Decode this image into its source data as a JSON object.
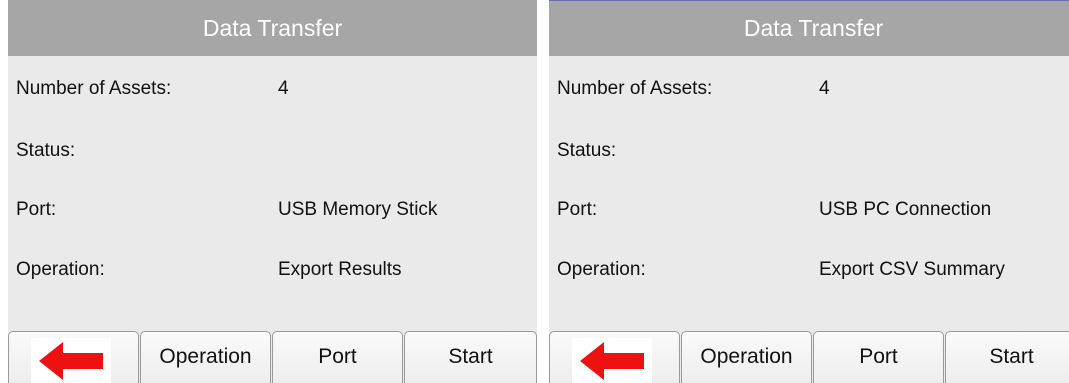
{
  "panels": [
    {
      "title": "Data Transfer",
      "number_of_assets_label": "Number of Assets:",
      "number_of_assets_value": "4",
      "status_label": "Status:",
      "status_value": "",
      "port_label": "Port:",
      "port_value": "USB Memory Stick",
      "operation_label": "Operation:",
      "operation_value": "Export Results",
      "buttons": {
        "back_icon": "left-arrow-icon",
        "operation": "Operation",
        "port": "Port",
        "start": "Start"
      }
    },
    {
      "title": "Data Transfer",
      "number_of_assets_label": "Number of Assets:",
      "number_of_assets_value": "4",
      "status_label": "Status:",
      "status_value": "",
      "port_label": "Port:",
      "port_value": "USB PC Connection",
      "operation_label": "Operation:",
      "operation_value": "Export CSV Summary",
      "buttons": {
        "back_icon": "left-arrow-icon",
        "operation": "Operation",
        "port": "Port",
        "start": "Start"
      }
    }
  ],
  "colors": {
    "title_bar": "#a6a6a6",
    "panel_background": "#eaeaea",
    "back_arrow": "#ee1111"
  }
}
